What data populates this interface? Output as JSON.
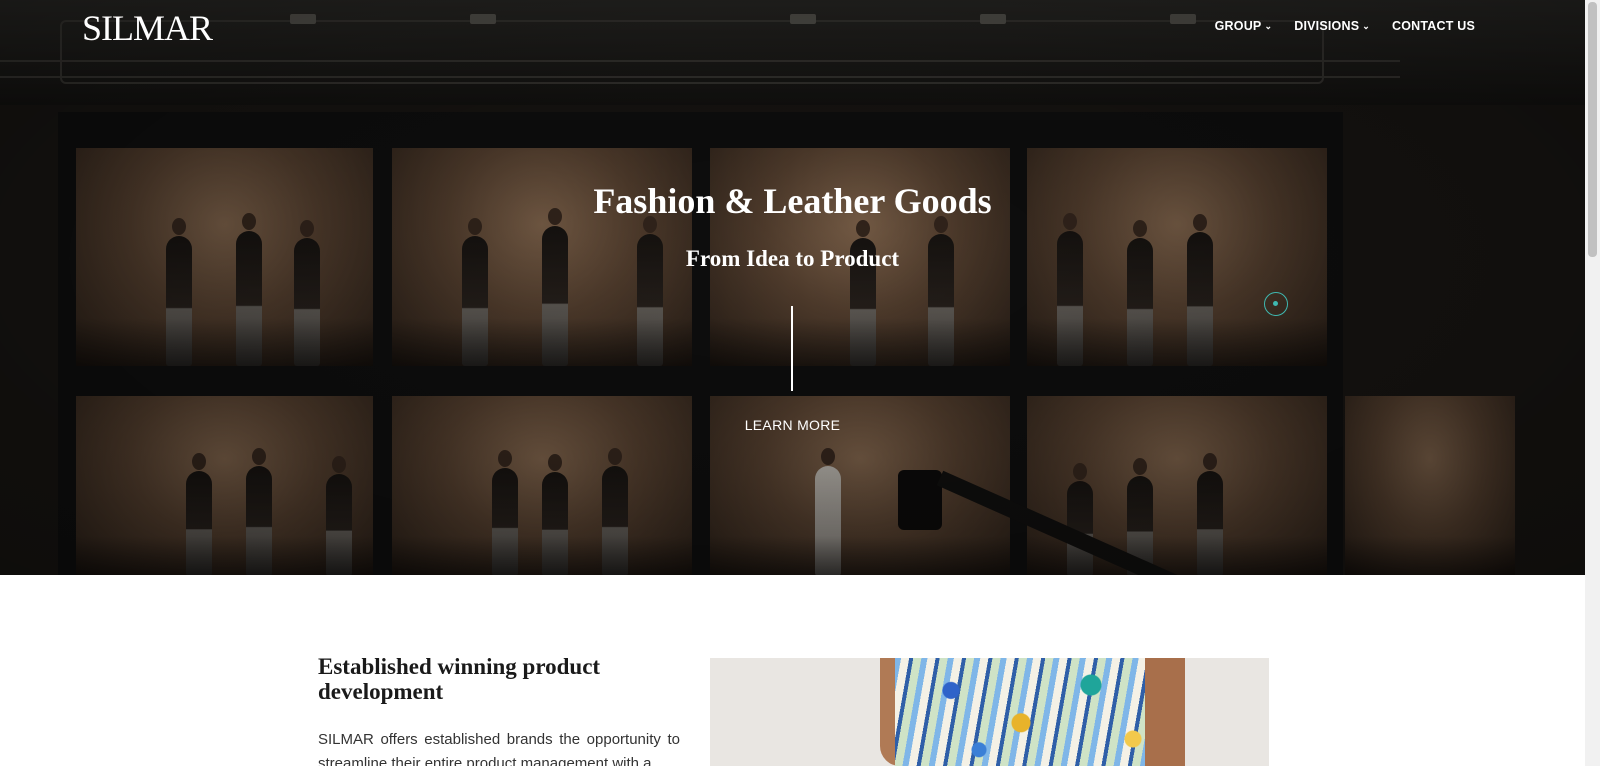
{
  "header": {
    "logo": "SILMAR",
    "nav": [
      {
        "label": "GROUP",
        "has_dropdown": true
      },
      {
        "label": "DIVISIONS",
        "has_dropdown": true
      },
      {
        "label": "CONTACT US",
        "has_dropdown": false
      }
    ]
  },
  "hero": {
    "title": "Fashion & Leather Goods",
    "subtitle": "From Idea to Product",
    "cta_label": "LEARN MORE"
  },
  "intro": {
    "heading": "Established winning product development",
    "body": "SILMAR offers established brands the opportunity to streamline their entire product management with a"
  },
  "icons": {
    "dropdown": "chevron-down-icon",
    "cursor": "cursor-ring-icon"
  },
  "colors": {
    "accent": "#3fb8b0",
    "hero_text": "#ffffff",
    "heading_text": "#1a1a1a"
  }
}
